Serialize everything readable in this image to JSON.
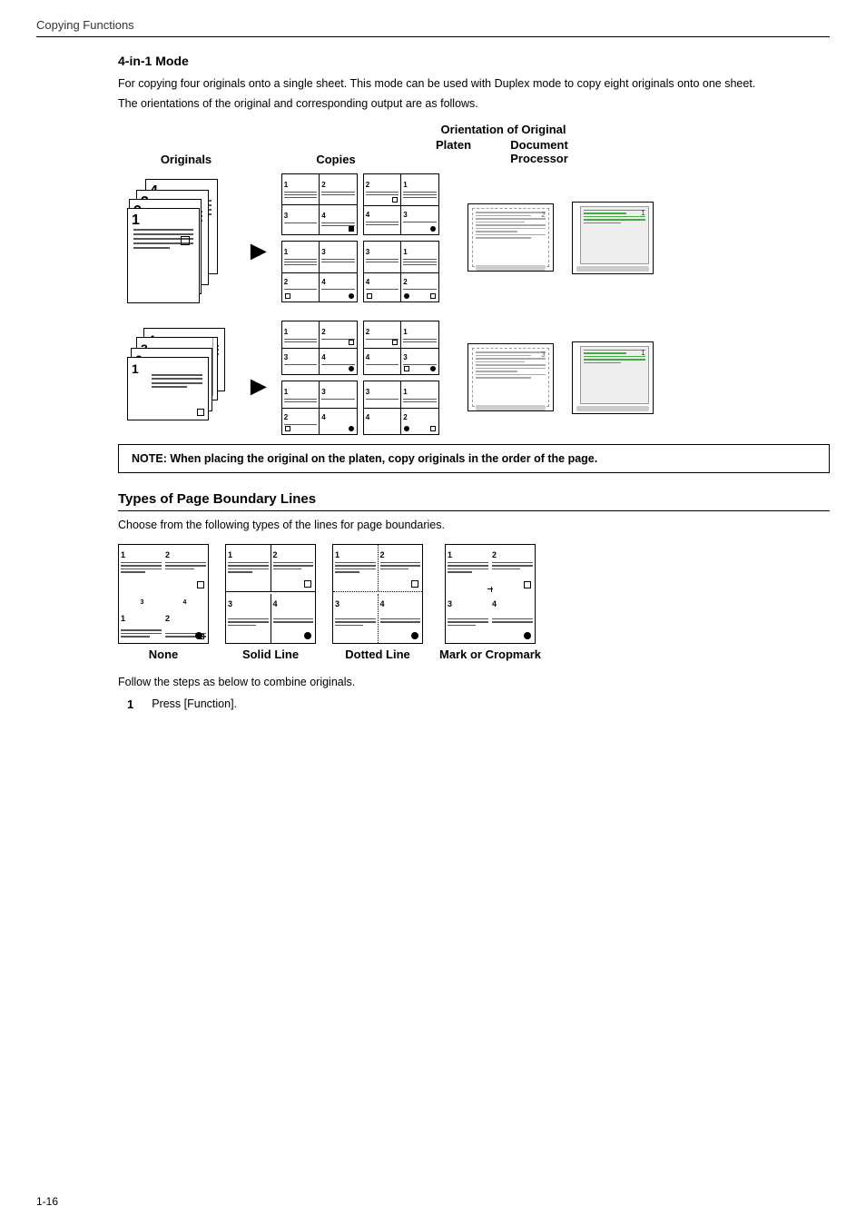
{
  "header": {
    "title": "Copying Functions"
  },
  "section1": {
    "title": "4-in-1 Mode",
    "desc1": "For copying four originals onto a single sheet. This mode can be used with Duplex mode to copy eight originals onto one sheet.",
    "desc2": "The orientations of the original and corresponding output are as follows.",
    "col_originals": "Originals",
    "col_copies": "Copies",
    "col_orientation": "Orientation of Original",
    "col_platen": "Platen",
    "col_docproc": "Document Processor",
    "note": "NOTE: When placing the original on the platen, copy originals in the order of the page."
  },
  "section2": {
    "title": "Types of Page Boundary Lines",
    "desc": "Choose from the following types of the lines for page boundaries.",
    "types": [
      {
        "label": "None"
      },
      {
        "label": "Solid Line"
      },
      {
        "label": "Dotted Line"
      },
      {
        "label": "Mark or Cropmark"
      }
    ],
    "follow": "Follow the steps as below to combine originals.",
    "step1_num": "1",
    "step1_text": "Press [Function]."
  },
  "footer": {
    "page": "1-16"
  }
}
